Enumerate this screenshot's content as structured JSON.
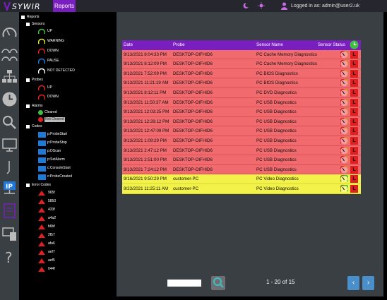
{
  "topbar": {
    "logo_text": "SYWIR",
    "tab_label": "Reports",
    "login_text": "Logged in as: admin@user2.uk"
  },
  "tree": {
    "root": "Reports",
    "sensors_label": "Sensors",
    "sensors": [
      "UP",
      "WARNING",
      "DOWN",
      "PAUSE",
      "NOT DETECTED"
    ],
    "probes_label": "Probes",
    "probes": [
      "UP",
      "DOWN"
    ],
    "alarms_label": "Alarms",
    "alarms": [
      "Cleared",
      "Not Cleared"
    ],
    "codes_label": "Codes",
    "codes": [
      "p:ProbeStart",
      "p:ProbeStop",
      "p:DScan",
      "p:SetAlarm",
      "c:ConsoleStart",
      "c:ProbeCreated"
    ],
    "error_codes_label": "Error Codes",
    "error_codes": [
      "965f",
      "5850",
      "433f",
      "a4a2",
      "b6bf",
      "2f57",
      "afa6",
      "aef7",
      "aef5",
      "044f"
    ]
  },
  "table": {
    "headers": {
      "date": "Date",
      "probe": "Probe",
      "name": "Sensor Name",
      "status": "Sensor Status"
    },
    "status_letter": "L",
    "rows": [
      {
        "date": "9/13/2021 8:04:33 PM",
        "probe": "DESKTOP-OIFHID6",
        "name": "PC Cache Memory Diagnostics",
        "kind": "red"
      },
      {
        "date": "9/13/2021 8:12:09 PM",
        "probe": "DESKTOP-OIFHID6",
        "name": "PC Cache Memory Diagnostics",
        "kind": "red"
      },
      {
        "date": "9/12/2021 7:52:09 PM",
        "probe": "DESKTOP-OIFHID6",
        "name": "PC BIOS Diagnostics",
        "kind": "red"
      },
      {
        "date": "9/13/2021 11:21:19 AM",
        "probe": "DESKTOP-OIFHID6",
        "name": "PC BIOS Diagnostics",
        "kind": "red"
      },
      {
        "date": "9/13/2021 8:12:11 PM",
        "probe": "DESKTOP-OIFHID6",
        "name": "PC DVD Diagnostics",
        "kind": "red"
      },
      {
        "date": "9/13/2021 11:50:37 AM",
        "probe": "DESKTOP-OIFHID6",
        "name": "PC USB Diagnostics",
        "kind": "red"
      },
      {
        "date": "9/13/2021 12:03:25 PM",
        "probe": "DESKTOP-OIFHID6",
        "name": "PC USB Diagnostics",
        "kind": "red"
      },
      {
        "date": "9/13/2021 12:28:12 PM",
        "probe": "DESKTOP-OIFHID6",
        "name": "PC USB Diagnostics",
        "kind": "red"
      },
      {
        "date": "9/13/2021 12:47:09 PM",
        "probe": "DESKTOP-OIFHID6",
        "name": "PC USB Diagnostics",
        "kind": "red"
      },
      {
        "date": "9/13/2021 1:09:29 PM",
        "probe": "DESKTOP-OIFHID6",
        "name": "PC USB Diagnostics",
        "kind": "red"
      },
      {
        "date": "9/13/2021 2:47:12 PM",
        "probe": "DESKTOP-OIFHID6",
        "name": "PC USB Diagnostics",
        "kind": "red"
      },
      {
        "date": "9/13/2021 2:51:00 PM",
        "probe": "DESKTOP-OIFHID6",
        "name": "PC USB Diagnostics",
        "kind": "red"
      },
      {
        "date": "9/13/2021 7:24:12 PM",
        "probe": "DESKTOP-OIFHID6",
        "name": "PC USB Diagnostics",
        "kind": "red"
      },
      {
        "date": "9/16/2021 9:50:29 PM",
        "probe": "customer-PC",
        "name": "PC Video Diagnostics",
        "kind": "yellow"
      },
      {
        "date": "9/23/2021 11:25:11 AM",
        "probe": "customer-PC",
        "name": "PC Video Diagnostics",
        "kind": "yellow"
      }
    ]
  },
  "pager": {
    "page_text": "1 - 20 of 15",
    "input_value": "",
    "prev": "‹",
    "next": "›"
  },
  "colors": {
    "accent": "#7a1fbf",
    "red_row": "#f06a6e",
    "yellow_row": "#f2f24a",
    "panel": "#3a3f44",
    "nav": "#4a8fc9"
  }
}
